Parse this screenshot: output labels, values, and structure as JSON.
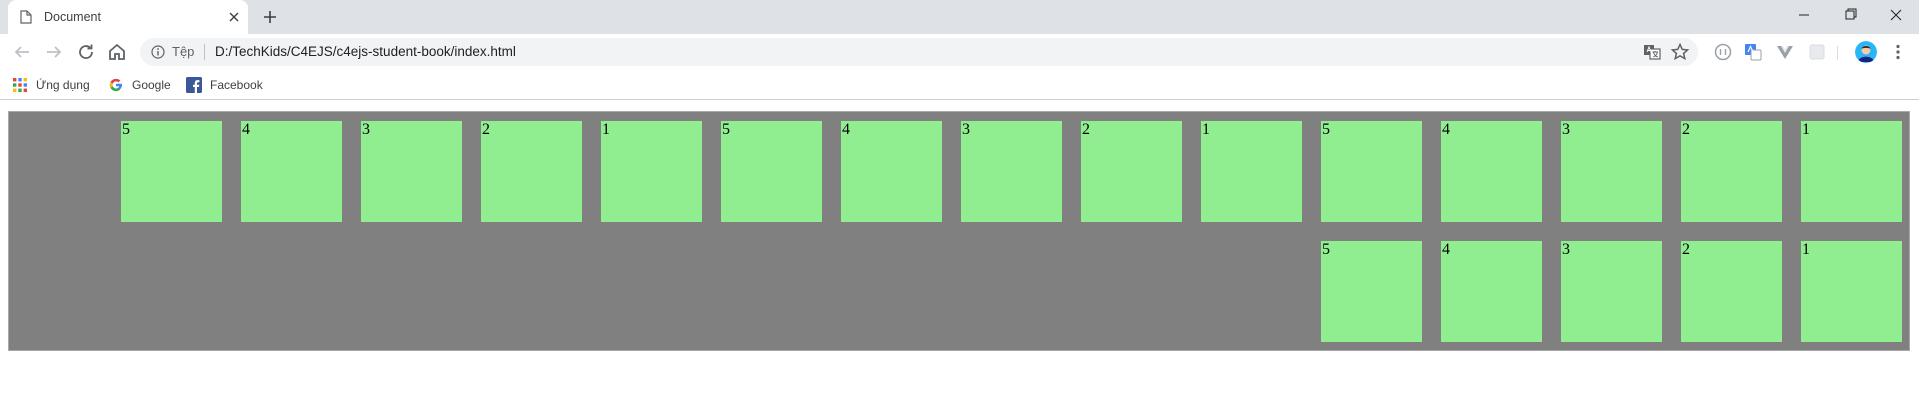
{
  "tab": {
    "title": "Document",
    "favicon": "document-icon"
  },
  "window_controls": [
    "minimize-icon",
    "maximize-icon",
    "close-icon"
  ],
  "toolbar": {
    "nav_icons": [
      "back-arrow-icon",
      "forward-arrow-icon",
      "reload-icon",
      "home-icon"
    ],
    "scheme_label": "Tệp",
    "url": "D:/TechKids/C4EJS/c4ejs-student-book/index.html"
  },
  "bookmarks": [
    {
      "label": "Ứng dụng",
      "icon": "apps-grid-icon"
    },
    {
      "label": "Google",
      "icon": "google-icon"
    },
    {
      "label": "Facebook",
      "icon": "facebook-icon"
    }
  ],
  "colors": {
    "container_bg": "#808080",
    "square_bg": "#90ee90"
  },
  "content": {
    "row1": [
      "5",
      "4",
      "3",
      "2",
      "1",
      "5",
      "4",
      "3",
      "2",
      "1",
      "5",
      "4",
      "3",
      "2",
      "1"
    ],
    "row2": [
      "5",
      "4",
      "3",
      "2",
      "1"
    ]
  }
}
